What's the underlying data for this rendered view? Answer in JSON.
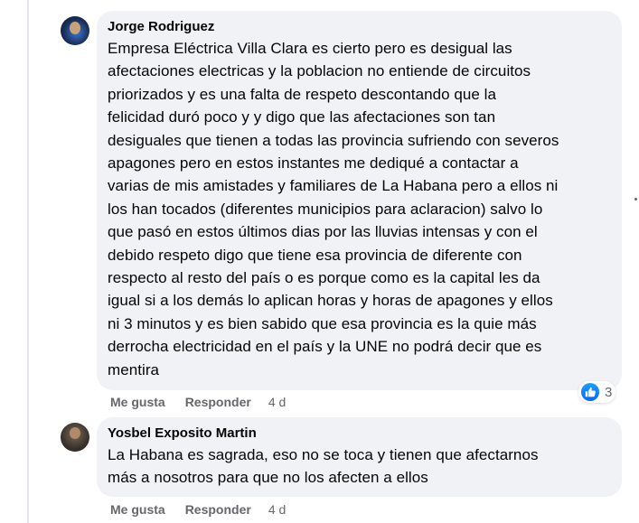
{
  "comments": [
    {
      "author": "Jorge Rodriguez",
      "text": "Empresa Eléctrica Villa Clara es cierto pero es desigual las\nafectaciones electricas y la poblacion no entiende de circuitos\npriorizados y es una falta de respeto descontando que la\nfelicidad duró poco y y digo que las afectaciones son tan\ndesiguales que tienen a todas las provincia sufriendo con severos\napagones pero en estos instantes me dediqué a contactar a\nvarias de mis amistades y familiares de La Habana pero a ellos ni\nlos han tocados (diferentes municipios para aclaracion) salvo lo\nque pasó en estos últimos dias por las lluvias intensas y con el\ndebido respeto digo que tiene esa provincia de diferente con\nrespecto al resto del país o es porque como es la capital les da\nigual si a los demás lo aplican horas y horas de apagones y ellos\nni 3 minutos y es bien sabido que esa provincia es la quie más\nderrocha electricidad en el país y la UNE no podrá decir que es\nmentira",
      "like_label": "Me gusta",
      "reply_label": "Responder",
      "time": "4 d",
      "reaction_count": "3"
    },
    {
      "author": "Yosbel Exposito Martin",
      "text": "La Habana es sagrada, eso no se toca y tienen que afectarnos\nmás a nosotros para que no los afecten a ellos",
      "like_label": "Me gusta",
      "reply_label": "Responder",
      "time": "4 d"
    }
  ],
  "colors": {
    "bubble": "#f0f2f5",
    "meta_text": "#65676b",
    "like_blue": "#0866ff"
  },
  "icons": [
    "avatar-jorge",
    "avatar-yosbel",
    "like-reaction-icon"
  ]
}
